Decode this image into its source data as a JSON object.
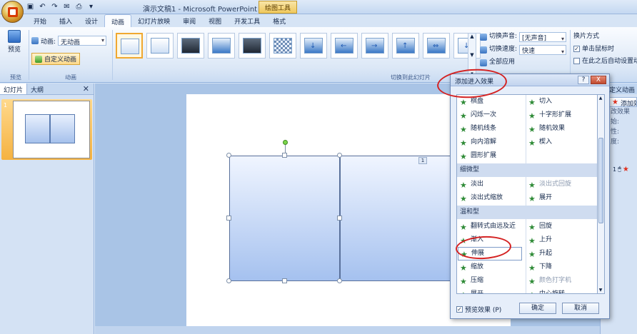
{
  "app": {
    "title": "演示文稿1 - Microsoft PowerPoint",
    "tool_tab": "绘图工具",
    "qat_icons": [
      "save-icon",
      "undo-icon",
      "redo-icon",
      "mail-icon",
      "print-icon",
      "arrow-icon"
    ]
  },
  "ribbon": {
    "tabs": [
      "开始",
      "插入",
      "设计",
      "动画",
      "幻灯片放映",
      "审阅",
      "视图",
      "开发工具",
      "格式"
    ],
    "active_tab": "动画",
    "preview_label": "预览",
    "preview_group_label": "预览",
    "animation_label": "动画:",
    "animation_value": "无动画",
    "custom_animation_label": "自定义动画",
    "animation_group_label": "动画",
    "transition_group_label": "切换到此幻灯片",
    "sound_label": "切换声音:",
    "sound_value": "[无声音]",
    "speed_label": "切换速度:",
    "speed_value": "快速",
    "apply_all_label": "全部应用",
    "advance_title": "换片方式",
    "on_click_label": "单击鼠标时",
    "on_click_checked": true,
    "auto_label": "在此之后自动设置动"
  },
  "left_panel": {
    "tabs": [
      "幻灯片",
      "大纲"
    ],
    "close": "✕",
    "slide_number": "1"
  },
  "canvas": {
    "shape_tag": "1"
  },
  "task_pane": {
    "title": "定义动画",
    "add_effect": "添加效",
    "lines": [
      "改效果",
      "始:",
      "性:",
      "度:"
    ],
    "item_number": "1"
  },
  "dialog": {
    "title": "添加进入效果",
    "help": "?",
    "close": "X",
    "top_rows": [
      [
        "棋盘",
        "切入"
      ],
      [
        "闪烁一次",
        "十字形扩展"
      ],
      [
        "随机线条",
        "随机效果"
      ],
      [
        "向内溶解",
        "楔入"
      ],
      [
        "圆形扩展",
        ""
      ]
    ],
    "category_subtle": "细微型",
    "subtle_rows": [
      [
        "淡出",
        "淡出式回旋"
      ],
      [
        "淡出式缩放",
        "展开"
      ]
    ],
    "category_moderate": "温和型",
    "moderate_rows": [
      [
        "翻转式由远及近",
        "回旋"
      ],
      [
        "渐入",
        "上升"
      ],
      [
        "伸展",
        "升起"
      ],
      [
        "缩放",
        "下降"
      ],
      [
        "压缩",
        "颜色打字机"
      ],
      [
        "展开",
        "中心旋转"
      ]
    ],
    "preview_checkbox": "预览效果 (P)",
    "preview_checked": true,
    "ok": "确定",
    "cancel": "取消"
  }
}
